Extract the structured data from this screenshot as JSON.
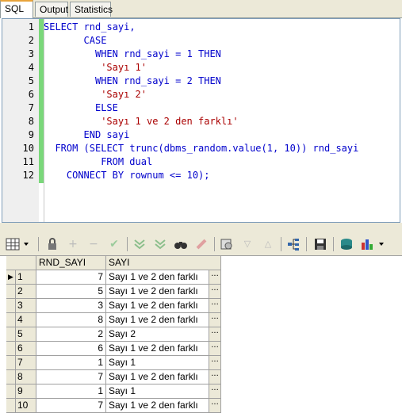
{
  "tabs": {
    "sql": "SQL",
    "output": "Output",
    "statistics": "Statistics"
  },
  "editor": {
    "lines": [
      {
        "num": "1",
        "tokens": [
          {
            "t": "SELECT rnd_sayi,",
            "c": "kw",
            "indent": 0
          }
        ]
      },
      {
        "num": "2",
        "tokens": [
          {
            "t": "CASE",
            "c": "kw",
            "indent": 7
          }
        ]
      },
      {
        "num": "3",
        "tokens": [
          {
            "t": "WHEN rnd_sayi = 1 THEN",
            "c": "kw",
            "indent": 9
          }
        ]
      },
      {
        "num": "4",
        "tokens": [
          {
            "t": "'Sayı 1'",
            "c": "str",
            "indent": 10
          }
        ]
      },
      {
        "num": "5",
        "tokens": [
          {
            "t": "WHEN rnd_sayi = 2 THEN",
            "c": "kw",
            "indent": 9
          }
        ]
      },
      {
        "num": "6",
        "tokens": [
          {
            "t": "'Sayı 2'",
            "c": "str",
            "indent": 10
          }
        ]
      },
      {
        "num": "7",
        "tokens": [
          {
            "t": "ELSE",
            "c": "kw",
            "indent": 9
          }
        ]
      },
      {
        "num": "8",
        "tokens": [
          {
            "t": "'Sayı 1 ve 2 den farklı'",
            "c": "str",
            "indent": 10
          }
        ]
      },
      {
        "num": "9",
        "tokens": [
          {
            "t": "END sayi",
            "c": "kw",
            "indent": 7
          }
        ]
      },
      {
        "num": "10",
        "tokens": [
          {
            "t": "FROM (SELECT trunc(dbms_random.value(1, 10)) rnd_sayi",
            "c": "kw",
            "indent": 2
          }
        ]
      },
      {
        "num": "11",
        "tokens": [
          {
            "t": "FROM dual",
            "c": "kw",
            "indent": 10
          }
        ]
      },
      {
        "num": "12",
        "tokens": [
          {
            "t": "CONNECT BY rownum <= 10);",
            "c": "kw",
            "indent": 4
          }
        ]
      }
    ]
  },
  "toolbar": {
    "icons": [
      "grid-view-icon",
      "lock-icon",
      "add-record-icon",
      "delete-record-icon",
      "post-record-icon",
      "move-down-icon",
      "move-down-alt-icon",
      "find-icon",
      "clear-icon",
      "query-icon",
      "query-next-icon",
      "query-prev-icon",
      "link-icon",
      "save-icon",
      "export-icon",
      "chart-icon"
    ]
  },
  "grid": {
    "columns": [
      "RND_SAYI",
      "SAYI"
    ],
    "current_row_marker": "▶",
    "cell_button_label": "···",
    "rows": [
      {
        "n": "1",
        "rnd": "7",
        "sayi": "Sayı 1 ve 2 den farklı"
      },
      {
        "n": "2",
        "rnd": "5",
        "sayi": "Sayı 1 ve 2 den farklı"
      },
      {
        "n": "3",
        "rnd": "3",
        "sayi": "Sayı 1 ve 2 den farklı"
      },
      {
        "n": "4",
        "rnd": "8",
        "sayi": "Sayı 1 ve 2 den farklı"
      },
      {
        "n": "5",
        "rnd": "2",
        "sayi": "Sayı 2"
      },
      {
        "n": "6",
        "rnd": "6",
        "sayi": "Sayı 1 ve 2 den farklı"
      },
      {
        "n": "7",
        "rnd": "1",
        "sayi": "Sayı 1"
      },
      {
        "n": "8",
        "rnd": "7",
        "sayi": "Sayı 1 ve 2 den farklı"
      },
      {
        "n": "9",
        "rnd": "1",
        "sayi": "Sayı 1"
      },
      {
        "n": "10",
        "rnd": "7",
        "sayi": "Sayı 1 ve 2 den farklı"
      }
    ]
  }
}
